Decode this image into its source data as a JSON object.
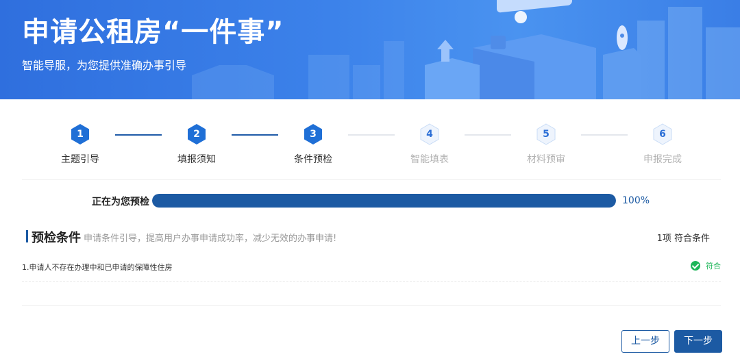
{
  "banner": {
    "title": "申请公租房“一件事”",
    "subtitle": "智能导服，为您提供准确办事引导"
  },
  "steps": [
    {
      "number": "1",
      "label": "主题引导",
      "state": "done"
    },
    {
      "number": "2",
      "label": "填报须知",
      "state": "done"
    },
    {
      "number": "3",
      "label": "条件预检",
      "state": "done"
    },
    {
      "number": "4",
      "label": "智能填表",
      "state": "todo"
    },
    {
      "number": "5",
      "label": "材料预审",
      "state": "todo"
    },
    {
      "number": "6",
      "label": "申报完成",
      "state": "todo"
    }
  ],
  "progress": {
    "label": "正在为您预检",
    "percent_text": "100%",
    "value": 100
  },
  "section": {
    "title": "预检条件",
    "description": "申请条件引导，提高用户办事申请成功率，减少无效的办事申请!",
    "count_text": "1项 符合条件"
  },
  "conditions": [
    {
      "text": "1.申请人不存在办理中和已申请的保障性住房",
      "status": "符合",
      "status_icon": "check-circle-icon"
    }
  ],
  "buttons": {
    "prev": "上一步",
    "next": "下一步"
  },
  "colors": {
    "primary": "#1c5aa3",
    "step_active": "#1f6fd6",
    "success": "#1db659",
    "banner": "#3c82ea"
  }
}
